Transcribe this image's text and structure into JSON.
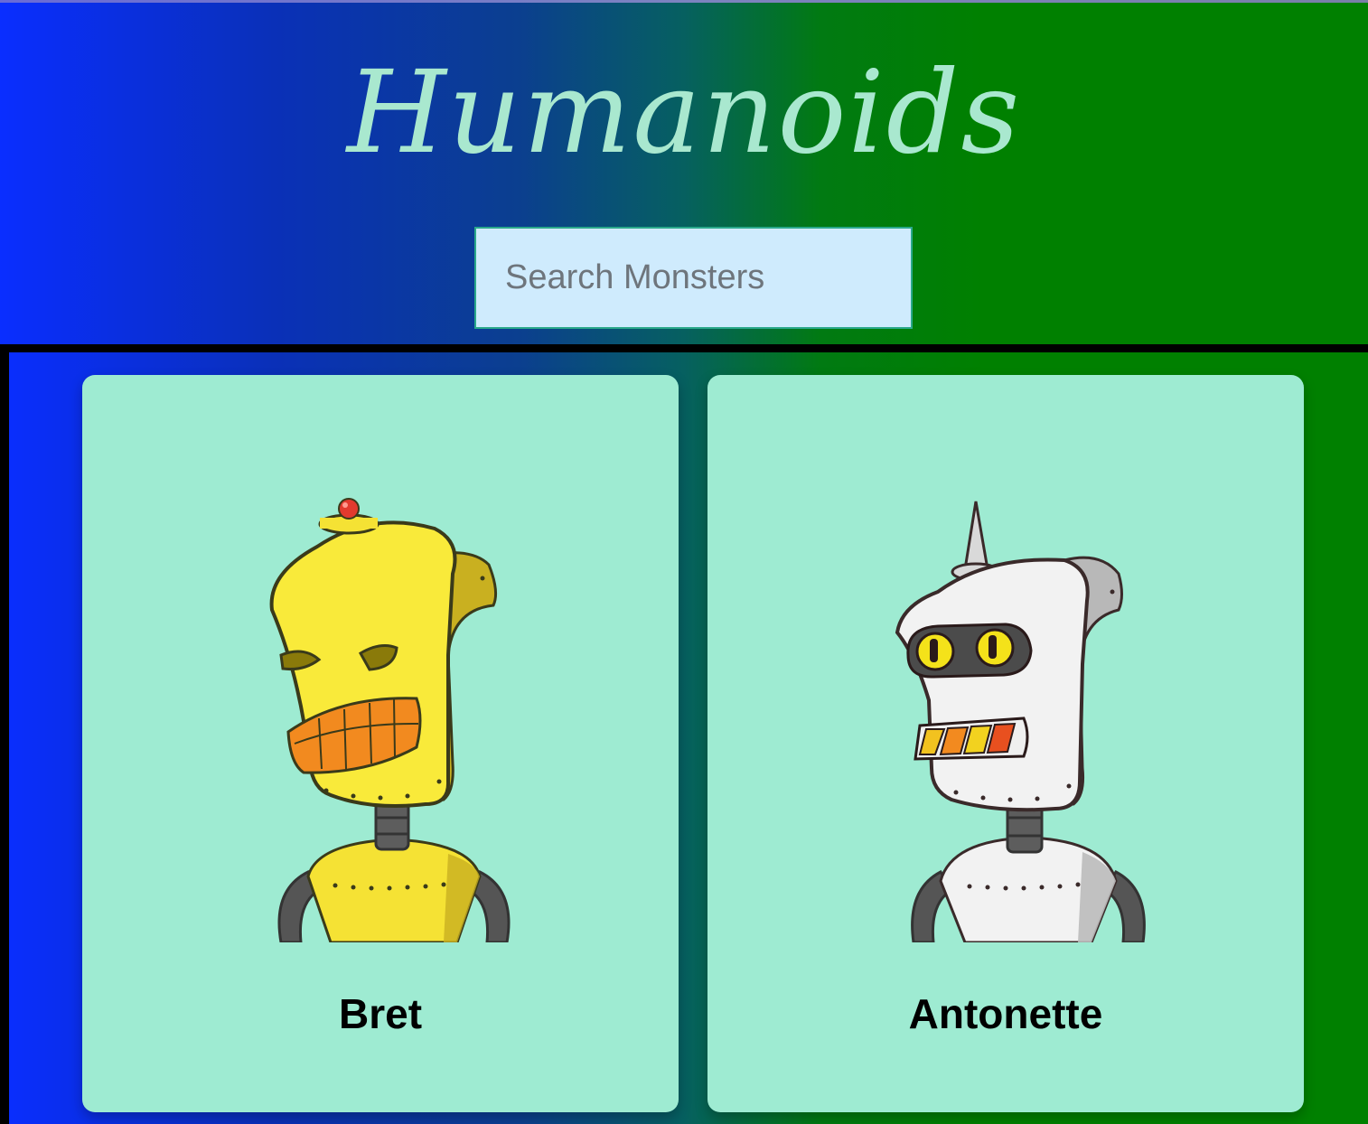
{
  "header": {
    "title": "Humanoids",
    "search": {
      "placeholder": "Search Monsters",
      "value": ""
    }
  },
  "colors": {
    "background_left": "#0a2eff",
    "background_right": "#008000",
    "title": "#a9e8cf",
    "search_bg": "#cfebfd",
    "card_bg": "#9eebd2"
  },
  "cards": [
    {
      "name": "Bret",
      "image": "yellow-robot-avatar"
    },
    {
      "name": "Antonette",
      "image": "white-robot-avatar"
    }
  ]
}
